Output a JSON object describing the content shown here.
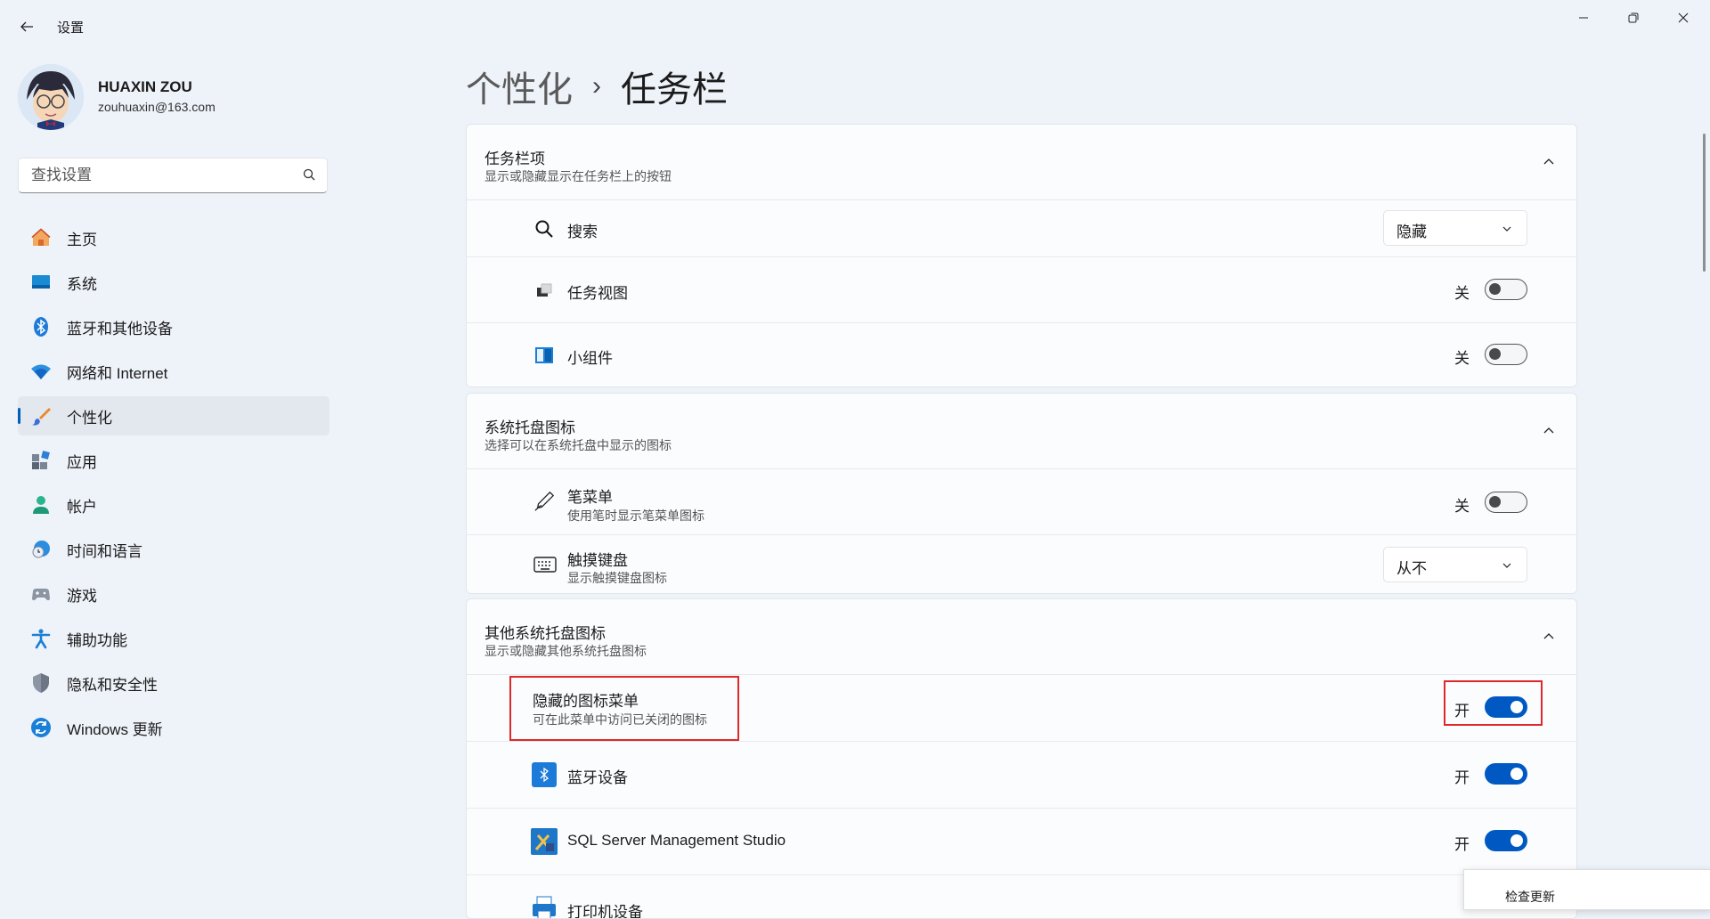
{
  "app": {
    "title": "设置"
  },
  "profile": {
    "name": "HUAXIN ZOU",
    "email": "zouhuaxin@163.com"
  },
  "search": {
    "placeholder": "查找设置"
  },
  "nav": [
    {
      "label": "主页",
      "icon": "home-icon"
    },
    {
      "label": "系统",
      "icon": "system-icon"
    },
    {
      "label": "蓝牙和其他设备",
      "icon": "bluetooth-icon"
    },
    {
      "label": "网络和 Internet",
      "icon": "wifi-icon"
    },
    {
      "label": "个性化",
      "icon": "brush-icon",
      "active": true
    },
    {
      "label": "应用",
      "icon": "apps-icon"
    },
    {
      "label": "帐户",
      "icon": "account-icon"
    },
    {
      "label": "时间和语言",
      "icon": "time-language-icon"
    },
    {
      "label": "游戏",
      "icon": "gamepad-icon"
    },
    {
      "label": "辅助功能",
      "icon": "accessibility-icon"
    },
    {
      "label": "隐私和安全性",
      "icon": "shield-icon"
    },
    {
      "label": "Windows 更新",
      "icon": "windows-update-icon"
    }
  ],
  "breadcrumb": {
    "parent": "个性化",
    "separator": "›",
    "current": "任务栏"
  },
  "sections": {
    "taskbar_items": {
      "title": "任务栏项",
      "subtitle": "显示或隐藏显示在任务栏上的按钮",
      "rows": {
        "search": {
          "label": "搜索",
          "value": "隐藏"
        },
        "task_view": {
          "label": "任务视图",
          "state": "关"
        },
        "widgets": {
          "label": "小组件",
          "state": "关"
        }
      }
    },
    "tray_icons": {
      "title": "系统托盘图标",
      "subtitle": "选择可以在系统托盘中显示的图标",
      "rows": {
        "pen_menu": {
          "label": "笔菜单",
          "desc": "使用笔时显示笔菜单图标",
          "state": "关"
        },
        "touch_keyboard": {
          "label": "触摸键盘",
          "desc": "显示触摸键盘图标",
          "value": "从不"
        }
      }
    },
    "other_tray": {
      "title": "其他系统托盘图标",
      "subtitle": "显示或隐藏其他系统托盘图标",
      "rows": {
        "hidden_menu": {
          "label": "隐藏的图标菜单",
          "desc": "可在此菜单中访问已关闭的图标",
          "state": "开"
        },
        "bluetooth": {
          "label": "蓝牙设备",
          "state": "开"
        },
        "ssms": {
          "label": "SQL Server Management Studio",
          "state": "开"
        },
        "printer": {
          "label": "打印机设备"
        }
      }
    }
  },
  "popup": {
    "label": "检查更新"
  },
  "colors": {
    "accent": "#0059c2",
    "highlight": "#e0272b"
  }
}
